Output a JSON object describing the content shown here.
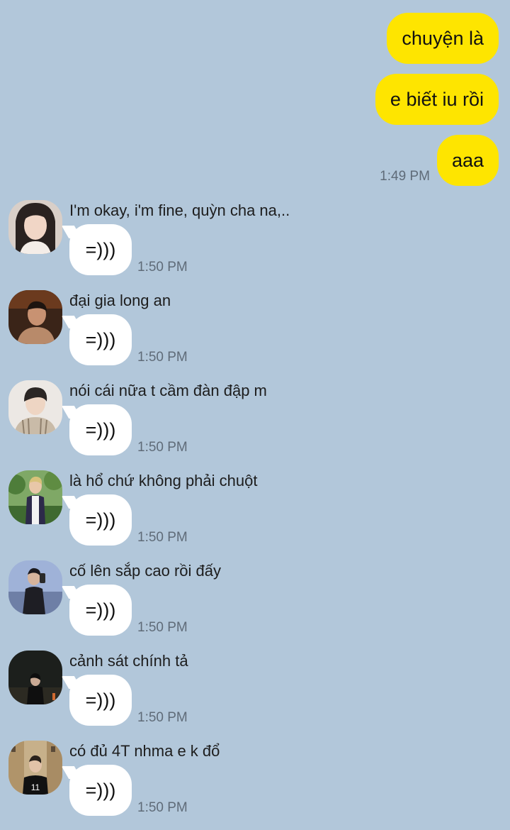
{
  "colors": {
    "background": "#b2c7da",
    "outgoing_bubble": "#fee500",
    "incoming_bubble": "#ffffff",
    "timestamp": "#5f6b78"
  },
  "outgoing": [
    {
      "text": "chuyện là",
      "time": ""
    },
    {
      "text": "e biết iu rồi",
      "time": ""
    },
    {
      "text": "aaa",
      "time": "1:49 PM"
    }
  ],
  "incoming": [
    {
      "sender": "I'm okay, i'm fine, quỳn cha na,..",
      "text": "=)))",
      "time": "1:50 PM",
      "avatar": "avatar-girl-icon"
    },
    {
      "sender": "đại gia long an",
      "text": "=)))",
      "time": "1:50 PM",
      "avatar": "avatar-man-dark-icon"
    },
    {
      "sender": "nói cái nữa t cầm đàn đập m",
      "text": "=)))",
      "time": "1:50 PM",
      "avatar": "avatar-man-light-icon"
    },
    {
      "sender": "là hổ chứ không phải chuột",
      "text": "=)))",
      "time": "1:50 PM",
      "avatar": "avatar-man-garden-icon"
    },
    {
      "sender": "cố lên sắp cao rồi đấy",
      "text": "=)))",
      "time": "1:50 PM",
      "avatar": "avatar-mirror-selfie-icon"
    },
    {
      "sender": "cảnh sát chính tả",
      "text": "=)))",
      "time": "1:50 PM",
      "avatar": "avatar-night-icon"
    },
    {
      "sender": "có đủ 4T nhma e k đổ",
      "text": "=)))",
      "time": "1:50 PM",
      "avatar": "avatar-street-icon"
    }
  ]
}
